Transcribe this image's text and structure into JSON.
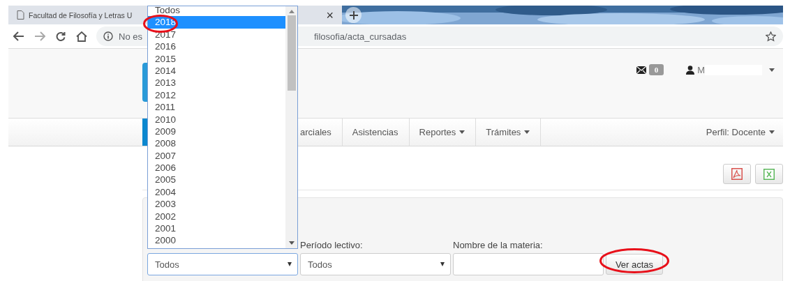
{
  "browser": {
    "tab_title": "Facultad de Filosofía y Letras U",
    "close_glyph": "×",
    "url_prefix": "No es",
    "url": "filosofia/acta_cursadas"
  },
  "header": {
    "unread_count": "0",
    "user_name": "M"
  },
  "nav": [
    {
      "label": "arciales",
      "dropdown": false
    },
    {
      "label": "Asistencias",
      "dropdown": false
    },
    {
      "label": "Reportes",
      "dropdown": true
    },
    {
      "label": "Trámites",
      "dropdown": true
    }
  ],
  "profile": {
    "label": "Perfil: Docente"
  },
  "filters": {
    "year_value": "Todos",
    "period_label": "Período lectivo:",
    "period_value": "Todos",
    "subject_label": "Nombre de la materia:",
    "submit": "Ver actas"
  },
  "year_options": [
    {
      "label": "Todos",
      "selected": false
    },
    {
      "label": "2018",
      "selected": true
    },
    {
      "label": "2017",
      "selected": false
    },
    {
      "label": "2016",
      "selected": false
    },
    {
      "label": "2015",
      "selected": false
    },
    {
      "label": "2014",
      "selected": false
    },
    {
      "label": "2013",
      "selected": false
    },
    {
      "label": "2012",
      "selected": false
    },
    {
      "label": "2011",
      "selected": false
    },
    {
      "label": "2010",
      "selected": false
    },
    {
      "label": "2009",
      "selected": false
    },
    {
      "label": "2008",
      "selected": false
    },
    {
      "label": "2007",
      "selected": false
    },
    {
      "label": "2006",
      "selected": false
    },
    {
      "label": "2005",
      "selected": false
    },
    {
      "label": "2004",
      "selected": false
    },
    {
      "label": "2003",
      "selected": false
    },
    {
      "label": "2002",
      "selected": false
    },
    {
      "label": "2001",
      "selected": false
    },
    {
      "label": "2000",
      "selected": false
    }
  ]
}
